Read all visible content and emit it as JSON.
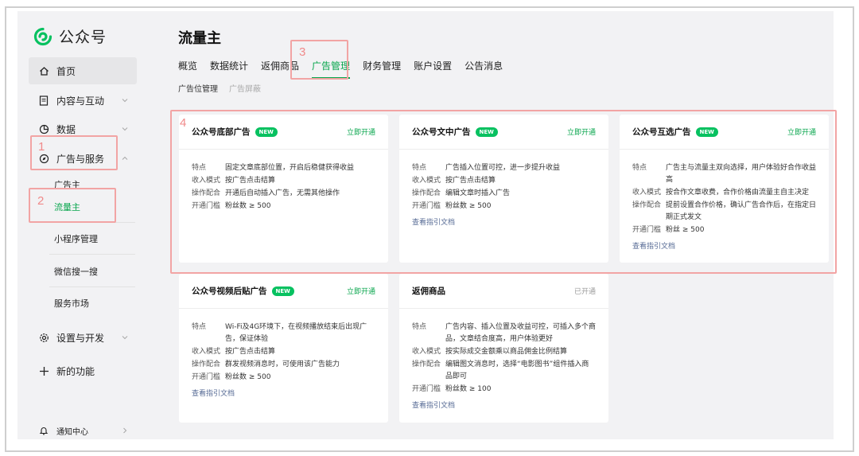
{
  "app": {
    "logo_text": "公众号"
  },
  "sidebar": {
    "items": [
      {
        "label": "首页"
      },
      {
        "label": "内容与互动"
      },
      {
        "label": "数据"
      },
      {
        "label": "广告与服务"
      },
      {
        "label": "设置与开发"
      },
      {
        "label": "新的功能"
      },
      {
        "label": "通知中心"
      }
    ],
    "sub_items": [
      {
        "label": "广告主"
      },
      {
        "label": "流量主"
      },
      {
        "label": "小程序管理"
      },
      {
        "label": "微信搜一搜"
      },
      {
        "label": "服务市场"
      }
    ]
  },
  "annotations": [
    "1",
    "2",
    "3",
    "4"
  ],
  "page": {
    "title": "流量主",
    "tabs": [
      "概览",
      "数据统计",
      "返佣商品",
      "广告管理",
      "财务管理",
      "账户设置",
      "公告消息"
    ],
    "subtabs": [
      "广告位管理",
      "广告屏蔽"
    ]
  },
  "cards": [
    {
      "title": "公众号底部广告",
      "badge": "NEW",
      "action": "立即开通",
      "rows": [
        {
          "k": "特点",
          "v": "固定文章底部位置，开启后稳健获得收益"
        },
        {
          "k": "收入模式",
          "v": "按广告点击结算"
        },
        {
          "k": "操作配合",
          "v": "开通后自动插入广告，无需其他操作"
        },
        {
          "k": "开通门槛",
          "v": "粉丝数 ≥ 500"
        }
      ],
      "link": ""
    },
    {
      "title": "公众号文中广告",
      "badge": "NEW",
      "action": "立即开通",
      "rows": [
        {
          "k": "特点",
          "v": "广告插入位置可控，进一步提升收益"
        },
        {
          "k": "收入模式",
          "v": "按广告点击结算"
        },
        {
          "k": "操作配合",
          "v": "编辑文章时插入广告"
        },
        {
          "k": "开通门槛",
          "v": "粉丝数 ≥ 500"
        }
      ],
      "link": "查看指引文档"
    },
    {
      "title": "公众号互选广告",
      "badge": "NEW",
      "action": "立即开通",
      "rows": [
        {
          "k": "特点",
          "v": "广告主与流量主双向选择，用户体验好合作收益高"
        },
        {
          "k": "收入模式",
          "v": "按合作文章收费，合作价格由流量主自主决定"
        },
        {
          "k": "操作配合",
          "v": "提前设置合作价格，确认广告合作后，在指定日期正式发文"
        },
        {
          "k": "开通门槛",
          "v": "粉丝 ≥ 500"
        }
      ],
      "link": "查看指引文档"
    },
    {
      "title": "公众号视频后贴广告",
      "badge": "NEW",
      "action": "立即开通",
      "rows": [
        {
          "k": "特点",
          "v": "Wi-Fi及4G环境下，在视频播放结束后出现广告，保证体验"
        },
        {
          "k": "收入模式",
          "v": "按广告点击结算"
        },
        {
          "k": "操作配合",
          "v": "群发视频消息时，可使用该广告能力"
        },
        {
          "k": "开通门槛",
          "v": "粉丝数 ≥ 500"
        }
      ],
      "link": "查看指引文档"
    },
    {
      "title": "返佣商品",
      "badge": "",
      "action": "已开通",
      "rows": [
        {
          "k": "特点",
          "v": "广告内容、插入位置及收益可控，可插入多个商品，文章结合度高，用户体验更好"
        },
        {
          "k": "收入模式",
          "v": "按实际成交金额乘以商品佣金比例结算"
        },
        {
          "k": "操作配合",
          "v": "编辑图文消息时，选择“电影图书”组件插入商品即可"
        },
        {
          "k": "开通门槛",
          "v": "粉丝数 ≥ 100"
        }
      ],
      "link": "查看指引文档"
    }
  ]
}
